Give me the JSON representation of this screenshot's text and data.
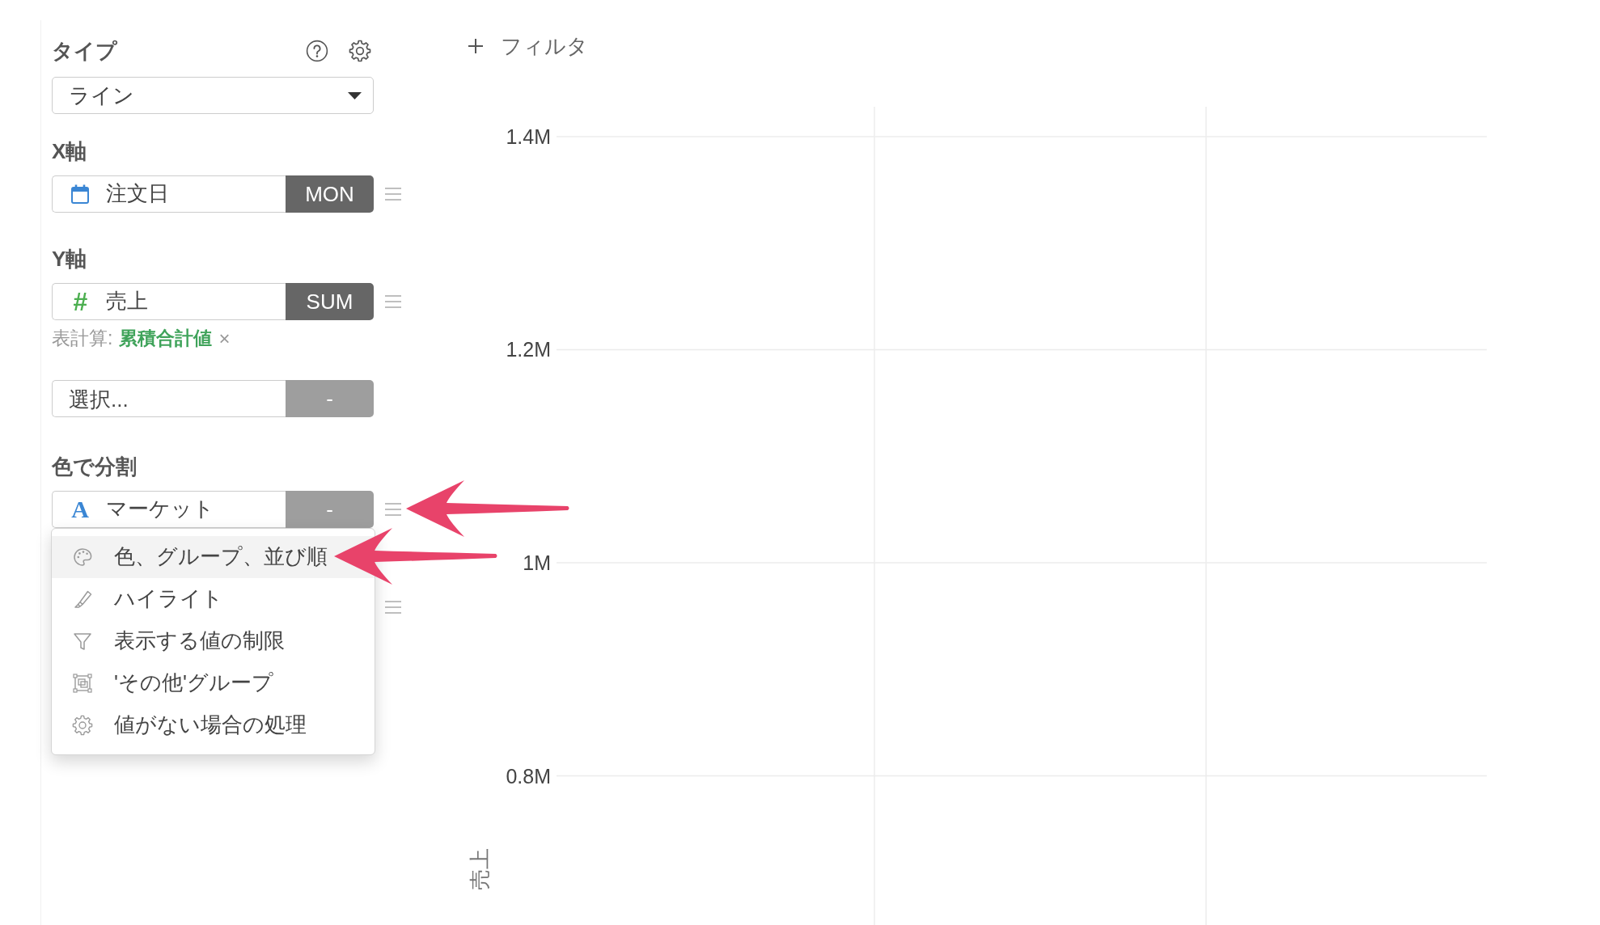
{
  "sidebar": {
    "type": {
      "label": "タイプ",
      "select": {
        "value": "ライン"
      }
    },
    "sections": [
      {
        "label": "X軸",
        "rows": [
          {
            "kind": "date",
            "field": "注文日",
            "button": {
              "label": "MON",
              "active": true
            },
            "handle": true,
            "callout": false
          }
        ]
      },
      {
        "label": "Y軸",
        "rows": [
          {
            "kind": "number",
            "glyph": "#",
            "field": "売上",
            "button": {
              "label": "SUM",
              "active": true
            },
            "handle": true,
            "callout": false,
            "table_calc": {
              "label": "表計算:",
              "value": "累積合計値",
              "remove": "×"
            }
          },
          {
            "kind": "empty",
            "placeholder": "選択...",
            "button": {
              "label": "-",
              "active": false
            },
            "handle": false,
            "callout": false
          }
        ]
      },
      {
        "label": "色で分割",
        "rows": [
          {
            "kind": "text",
            "glyph": "A",
            "field": "マーケット",
            "button": {
              "label": "-",
              "active": false
            },
            "handle": true,
            "callout": true,
            "menu": {
              "items": [
                {
                  "kind": "palette",
                  "label": "色、グループ、並び順",
                  "selected": true,
                  "callout": true
                },
                {
                  "kind": "highlight",
                  "label": "ハイライト",
                  "selected": false,
                  "callout": false
                },
                {
                  "kind": "filter",
                  "label": "表示する値の制限",
                  "selected": false,
                  "callout": false
                },
                {
                  "kind": "group",
                  "label": "'その他'グループ",
                  "selected": false,
                  "callout": false
                },
                {
                  "kind": "gear",
                  "label": "値がない場合の処理",
                  "selected": false,
                  "callout": false
                }
              ]
            }
          },
          {
            "kind": "covered",
            "handle": true,
            "callout": false
          }
        ]
      }
    ]
  },
  "filter": {
    "label": "フィルタ"
  },
  "chart": {
    "chart_data": {
      "type": "line",
      "ylabel": "売上",
      "categories": [
        null,
        null
      ],
      "ylim": [
        660000,
        1428000
      ],
      "yticks": [
        {
          "value": 1400000,
          "label": "1.4M"
        },
        {
          "value": 1200000,
          "label": "1.2M"
        },
        {
          "value": 1000000,
          "label": "1M"
        },
        {
          "value": 800000,
          "label": "0.8M"
        }
      ],
      "grid": true
    }
  }
}
